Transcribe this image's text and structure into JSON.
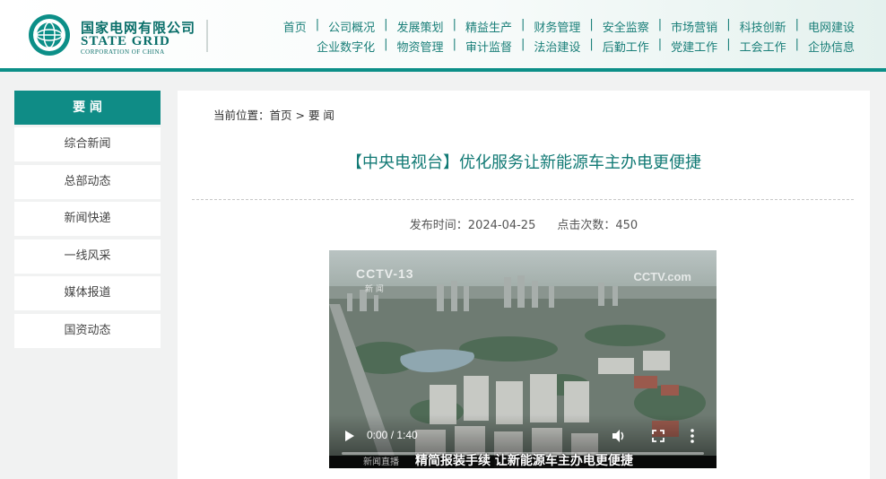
{
  "brand": {
    "name_cn": "国家电网有限公司",
    "name_en": "STATE GRID",
    "name_en_sub": "CORPORATION OF CHINA",
    "logo_icon": "state-grid-globe-logo",
    "accent": "#0c8f88"
  },
  "nav": {
    "row1": [
      "首页",
      "公司概况",
      "发展策划",
      "精益生产",
      "财务管理",
      "安全监察",
      "市场营销",
      "科技创新",
      "电网建设"
    ],
    "row2": [
      "企业数字化",
      "物资管理",
      "审计监督",
      "法治建设",
      "后勤工作",
      "党建工作",
      "工会工作",
      "企协信息"
    ],
    "separator": "|"
  },
  "sidebar": {
    "header": "要 闻",
    "items": [
      "综合新闻",
      "总部动态",
      "新闻快递",
      "一线风采",
      "媒体报道",
      "国资动态"
    ]
  },
  "breadcrumb": {
    "prefix": "当前位置：",
    "home": "首页",
    "sep": " > ",
    "current": "要 闻"
  },
  "article": {
    "title": "【中央电视台】优化服务让新能源车主办电更便捷",
    "publish_label": "发布时间：2024-04-25",
    "views_label": "点击次数：450"
  },
  "video": {
    "watermark_left": "CCTV-13",
    "watermark_left_sub": "新 闻",
    "watermark_right": "CCTV.com",
    "time": "0:00 / 1:40",
    "progress": 0,
    "subtitle_tag": "新闻直播",
    "subtitle": "精简报装手续 让新能源车主办电更便捷",
    "icons": [
      "play-icon",
      "volume-icon",
      "fullscreen-icon",
      "more-options-icon"
    ]
  }
}
